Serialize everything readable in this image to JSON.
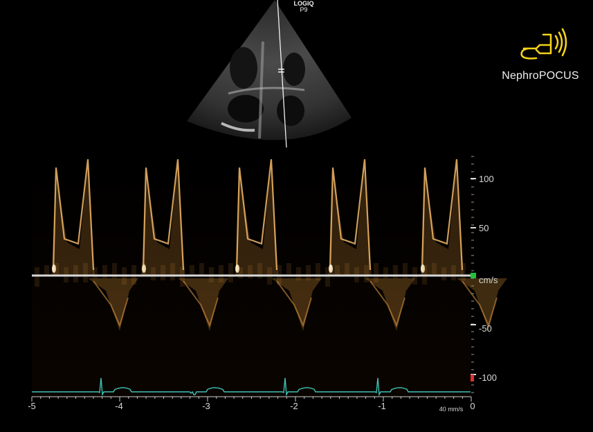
{
  "device": {
    "brand": "LOGIQ",
    "model": "P9"
  },
  "logo": {
    "name": "NephroPOCUS",
    "icon": "ultrasound-probe-icon",
    "color": "#f4d21a"
  },
  "velocity_scale": {
    "unit": "cm/s",
    "ticks": [
      "100",
      "50",
      "-50",
      "-100"
    ],
    "baseline_marker_color": "#22c23a",
    "bottom_marker_color": "#e03030"
  },
  "time_axis": {
    "ticks": [
      "-5",
      "-4",
      "-3",
      "-2",
      "-1",
      "0"
    ],
    "sweep_speed": "40 mm/s"
  },
  "colors": {
    "doppler": "#e39a3a",
    "ecg": "#3fc2b4",
    "baseline": "#d8d8d8"
  }
}
